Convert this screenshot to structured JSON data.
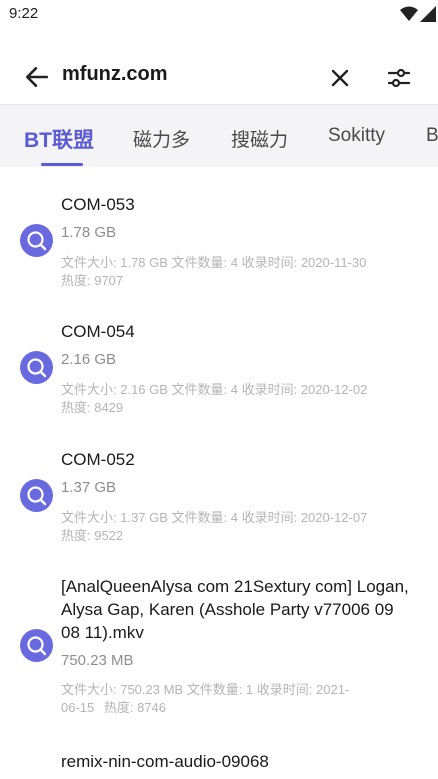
{
  "status_bar": {
    "time": "9:22"
  },
  "search": {
    "query": "mfunz.com"
  },
  "tabs": [
    "BT联盟",
    "磁力多",
    "搜磁力",
    "Sokitty",
    "B"
  ],
  "results": [
    {
      "title": "COM-053",
      "size": "1.78 GB",
      "meta": "文件大小: 1.78 GB  文件数量: 4  收录时间: 2020-11-30",
      "heat": "热度: 9707"
    },
    {
      "title": "COM-054",
      "size": "2.16 GB",
      "meta": "文件大小: 2.16 GB  文件数量: 4  收录时间: 2020-12-02",
      "heat": "热度: 8429"
    },
    {
      "title": "COM-052",
      "size": "1.37 GB",
      "meta": "文件大小: 1.37 GB  文件数量: 4  收录时间: 2020-12-07",
      "heat": "热度: 9522"
    },
    {
      "title": "[AnalQueenAlysa com 21Sextury com] Logan, Alysa Gap, Karen (Asshole Party v77006 09 08 11).mkv",
      "size": "750.23 MB",
      "meta": "文件大小: 750.23 MB  文件数量: 1  收录时间: 2021-06-15",
      "heat": "热度: 8746"
    },
    {
      "title": "remix-nin-com-audio-09068",
      "size": "",
      "meta": "",
      "heat": ""
    }
  ],
  "colors": {
    "accent": "#5b5bd6",
    "icon_bg": "#6a6ae0",
    "tab_bg": "#f4f4f6"
  }
}
